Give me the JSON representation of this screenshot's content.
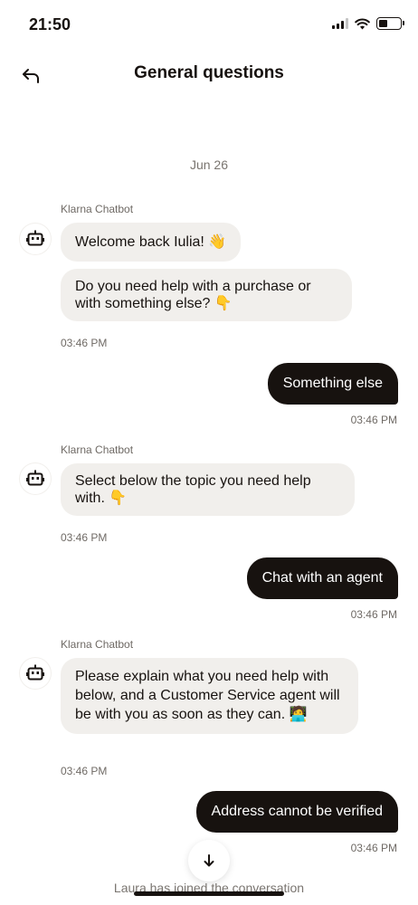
{
  "status_bar": {
    "time": "21:50"
  },
  "header": {
    "title": "General questions",
    "back_icon": "back-arrow-icon"
  },
  "date_label": "Jun 26",
  "messages": [
    {
      "type": "bot",
      "sender": "Klarna Chatbot",
      "bubbles": [
        {
          "text": "Welcome back Iulia!",
          "emoji": "👋"
        },
        {
          "text": "Do you need help with a purchase or with something else?",
          "emoji": "👇"
        }
      ],
      "time": "03:46 PM"
    },
    {
      "type": "user",
      "text": "Something else",
      "time": "03:46 PM"
    },
    {
      "type": "bot",
      "sender": "Klarna Chatbot",
      "bubbles": [
        {
          "text": "Select below the topic you need help with.",
          "emoji": "👇"
        }
      ],
      "time": "03:46 PM"
    },
    {
      "type": "user",
      "text": "Chat with an agent",
      "time": "03:46 PM"
    },
    {
      "type": "bot",
      "sender": "Klarna Chatbot",
      "bubbles": [
        {
          "text": "Please explain what you need help with below, and a Customer Service agent will be with you as soon as they can.",
          "emoji": "🧑‍💻"
        }
      ],
      "time": "03:46 PM"
    },
    {
      "type": "user",
      "text": "Address cannot be verified",
      "time": "03:46 PM"
    }
  ],
  "system_note": "Laura has joined the conversation",
  "colors": {
    "user_bubble": "#17120f",
    "bot_bubble": "#f1efec",
    "text": "#17120f",
    "muted": "#7a7570"
  }
}
